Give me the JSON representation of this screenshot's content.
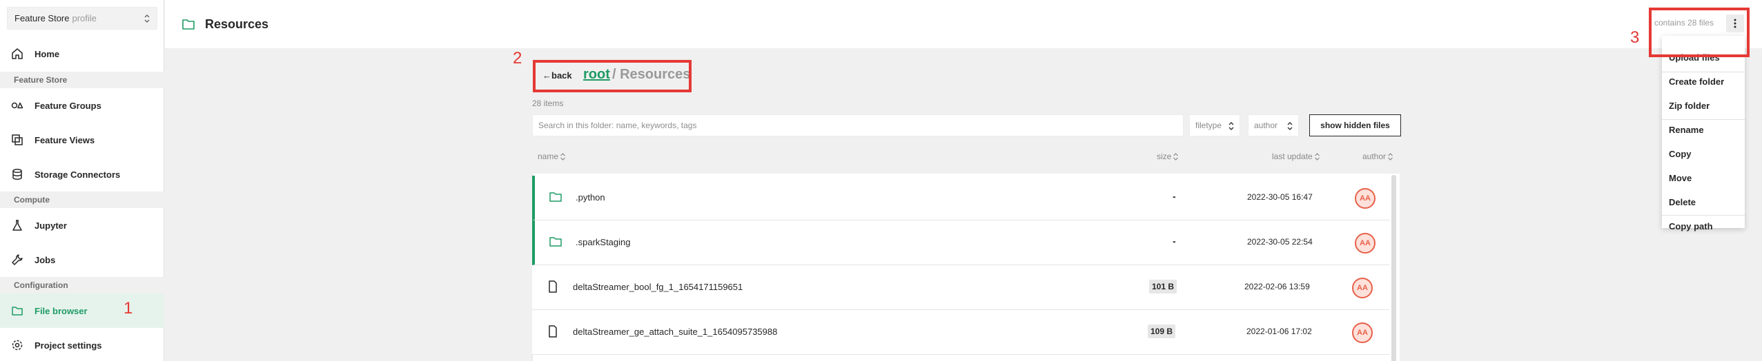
{
  "sidebar": {
    "project": {
      "name": "Feature Store",
      "type": "profile"
    },
    "items": [
      {
        "id": "home",
        "label": "Home",
        "icon": "home-icon"
      },
      {
        "id": "feature-groups",
        "label": "Feature Groups",
        "icon": "shapes-icon"
      },
      {
        "id": "feature-views",
        "label": "Feature Views",
        "icon": "layers-icon"
      },
      {
        "id": "storage-connectors",
        "label": "Storage Connectors",
        "icon": "database-icon"
      },
      {
        "id": "jupyter",
        "label": "Jupyter",
        "icon": "flask-icon"
      },
      {
        "id": "jobs",
        "label": "Jobs",
        "icon": "wrench-icon"
      },
      {
        "id": "file-browser",
        "label": "File browser",
        "icon": "folder-icon",
        "active": true
      },
      {
        "id": "project-settings",
        "label": "Project settings",
        "icon": "gear-icon"
      }
    ],
    "sections": [
      "Feature Store",
      "Compute",
      "Configuration"
    ]
  },
  "header": {
    "title": "Resources",
    "files_count": "contains 28 files"
  },
  "menu": {
    "items": [
      "Upload files",
      "Create folder",
      "Zip folder",
      "Rename",
      "Copy",
      "Move",
      "Delete",
      "Copy path"
    ]
  },
  "breadcrumb": {
    "back_label": "←back",
    "root": "root",
    "separator_path": "/ Resources"
  },
  "listing": {
    "count_label": "28 items",
    "search_placeholder": "Search in this folder: name, keywords, tags",
    "filetype_label": "filetype",
    "author_label": "author",
    "hidden_button": "show hidden files",
    "columns": {
      "name": "name",
      "size": "size",
      "last_update": "last update",
      "author": "author"
    },
    "rows": [
      {
        "name": ".python",
        "type": "folder",
        "size": "-",
        "date": "2022-30-05 16:47",
        "author": "AA"
      },
      {
        "name": ".sparkStaging",
        "type": "folder",
        "size": "-",
        "date": "2022-30-05 22:54",
        "author": "AA"
      },
      {
        "name": "deltaStreamer_bool_fg_1_1654171159651",
        "type": "file",
        "size": "101 B",
        "date": "2022-02-06 13:59",
        "author": "AA"
      },
      {
        "name": "deltaStreamer_ge_attach_suite_1_1654095735988",
        "type": "file",
        "size": "109 B",
        "date": "2022-01-06 17:02",
        "author": "AA"
      }
    ]
  },
  "annotations": {
    "one": "1",
    "two": "2",
    "three": "3"
  },
  "colors": {
    "accent": "#1e9b64",
    "annotation": "#e53935",
    "avatar": "#e8604a"
  }
}
